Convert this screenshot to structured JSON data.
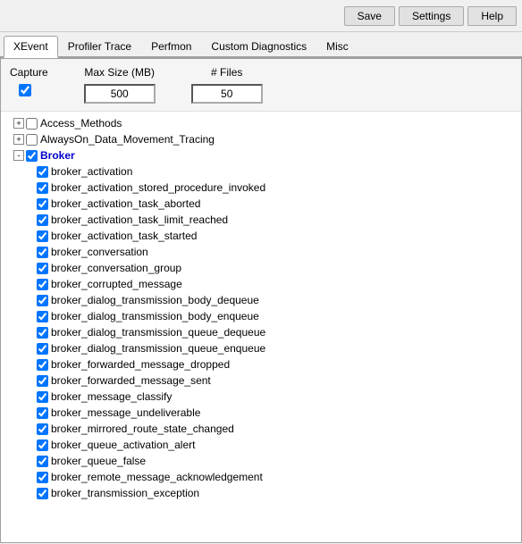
{
  "toolbar": {
    "save_label": "Save",
    "settings_label": "Settings",
    "help_label": "Help"
  },
  "tabs": [
    {
      "label": "XEvent",
      "active": true
    },
    {
      "label": "Profiler Trace",
      "active": false
    },
    {
      "label": "Perfmon",
      "active": false
    },
    {
      "label": "Custom Diagnostics",
      "active": false
    },
    {
      "label": "Misc",
      "active": false
    }
  ],
  "capture": {
    "label": "Capture",
    "checked": true,
    "maxsize_label": "Max Size (MB)",
    "maxsize_value": "500",
    "files_label": "# Files",
    "files_value": "50"
  },
  "tree": {
    "items": [
      {
        "id": "access_methods",
        "label": "Access_Methods",
        "level": 0,
        "expandable": true,
        "checked": false,
        "expanded": false
      },
      {
        "id": "alwayson",
        "label": "AlwaysOn_Data_Movement_Tracing",
        "level": 0,
        "expandable": true,
        "checked": false,
        "expanded": false
      },
      {
        "id": "broker",
        "label": "Broker",
        "level": 0,
        "expandable": true,
        "checked": true,
        "expanded": true,
        "blue": true
      },
      {
        "id": "broker_activation",
        "label": "broker_activation",
        "level": 1,
        "expandable": false,
        "checked": true
      },
      {
        "id": "broker_activation_stored_procedure_invoked",
        "label": "broker_activation_stored_procedure_invoked",
        "level": 1,
        "expandable": false,
        "checked": true
      },
      {
        "id": "broker_activation_task_aborted",
        "label": "broker_activation_task_aborted",
        "level": 1,
        "expandable": false,
        "checked": true
      },
      {
        "id": "broker_activation_task_limit_reached",
        "label": "broker_activation_task_limit_reached",
        "level": 1,
        "expandable": false,
        "checked": true
      },
      {
        "id": "broker_activation_task_started",
        "label": "broker_activation_task_started",
        "level": 1,
        "expandable": false,
        "checked": true
      },
      {
        "id": "broker_conversation",
        "label": "broker_conversation",
        "level": 1,
        "expandable": false,
        "checked": true
      },
      {
        "id": "broker_conversation_group",
        "label": "broker_conversation_group",
        "level": 1,
        "expandable": false,
        "checked": true
      },
      {
        "id": "broker_corrupted_message",
        "label": "broker_corrupted_message",
        "level": 1,
        "expandable": false,
        "checked": true
      },
      {
        "id": "broker_dialog_transmission_body_dequeue",
        "label": "broker_dialog_transmission_body_dequeue",
        "level": 1,
        "expandable": false,
        "checked": true
      },
      {
        "id": "broker_dialog_transmission_body_enqueue",
        "label": "broker_dialog_transmission_body_enqueue",
        "level": 1,
        "expandable": false,
        "checked": true
      },
      {
        "id": "broker_dialog_transmission_queue_dequeue",
        "label": "broker_dialog_transmission_queue_dequeue",
        "level": 1,
        "expandable": false,
        "checked": true
      },
      {
        "id": "broker_dialog_transmission_queue_enqueue",
        "label": "broker_dialog_transmission_queue_enqueue",
        "level": 1,
        "expandable": false,
        "checked": true
      },
      {
        "id": "broker_forwarded_message_dropped",
        "label": "broker_forwarded_message_dropped",
        "level": 1,
        "expandable": false,
        "checked": true
      },
      {
        "id": "broker_forwarded_message_sent",
        "label": "broker_forwarded_message_sent",
        "level": 1,
        "expandable": false,
        "checked": true
      },
      {
        "id": "broker_message_classify",
        "label": "broker_message_classify",
        "level": 1,
        "expandable": false,
        "checked": true
      },
      {
        "id": "broker_message_undeliverable",
        "label": "broker_message_undeliverable",
        "level": 1,
        "expandable": false,
        "checked": true
      },
      {
        "id": "broker_mirrored_route_state_changed",
        "label": "broker_mirrored_route_state_changed",
        "level": 1,
        "expandable": false,
        "checked": true
      },
      {
        "id": "broker_queue_activation_alert",
        "label": "broker_queue_activation_alert",
        "level": 1,
        "expandable": false,
        "checked": true
      },
      {
        "id": "broker_queue_false",
        "label": "broker_queue_false",
        "level": 1,
        "expandable": false,
        "checked": true
      },
      {
        "id": "broker_remote_message_acknowledgement",
        "label": "broker_remote_message_acknowledgement",
        "level": 1,
        "expandable": false,
        "checked": true
      },
      {
        "id": "broker_transmission_exception",
        "label": "broker_transmission_exception",
        "level": 1,
        "expandable": false,
        "checked": true
      }
    ]
  }
}
